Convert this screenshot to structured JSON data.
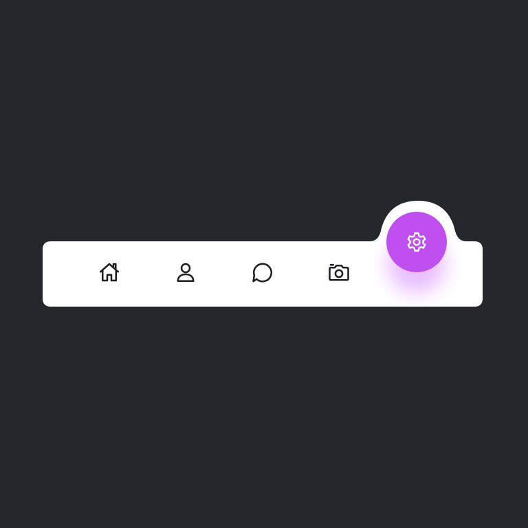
{
  "navbar": {
    "background_color": "#ffffff",
    "icon_color": "#1e2024",
    "items": [
      {
        "icon": "home-icon"
      },
      {
        "icon": "user-icon"
      },
      {
        "icon": "chat-icon"
      },
      {
        "icon": "camera-icon"
      }
    ],
    "active_item": {
      "icon": "settings-icon",
      "accent_color": "#c04ff0"
    }
  },
  "page": {
    "background_color": "#24272c"
  }
}
